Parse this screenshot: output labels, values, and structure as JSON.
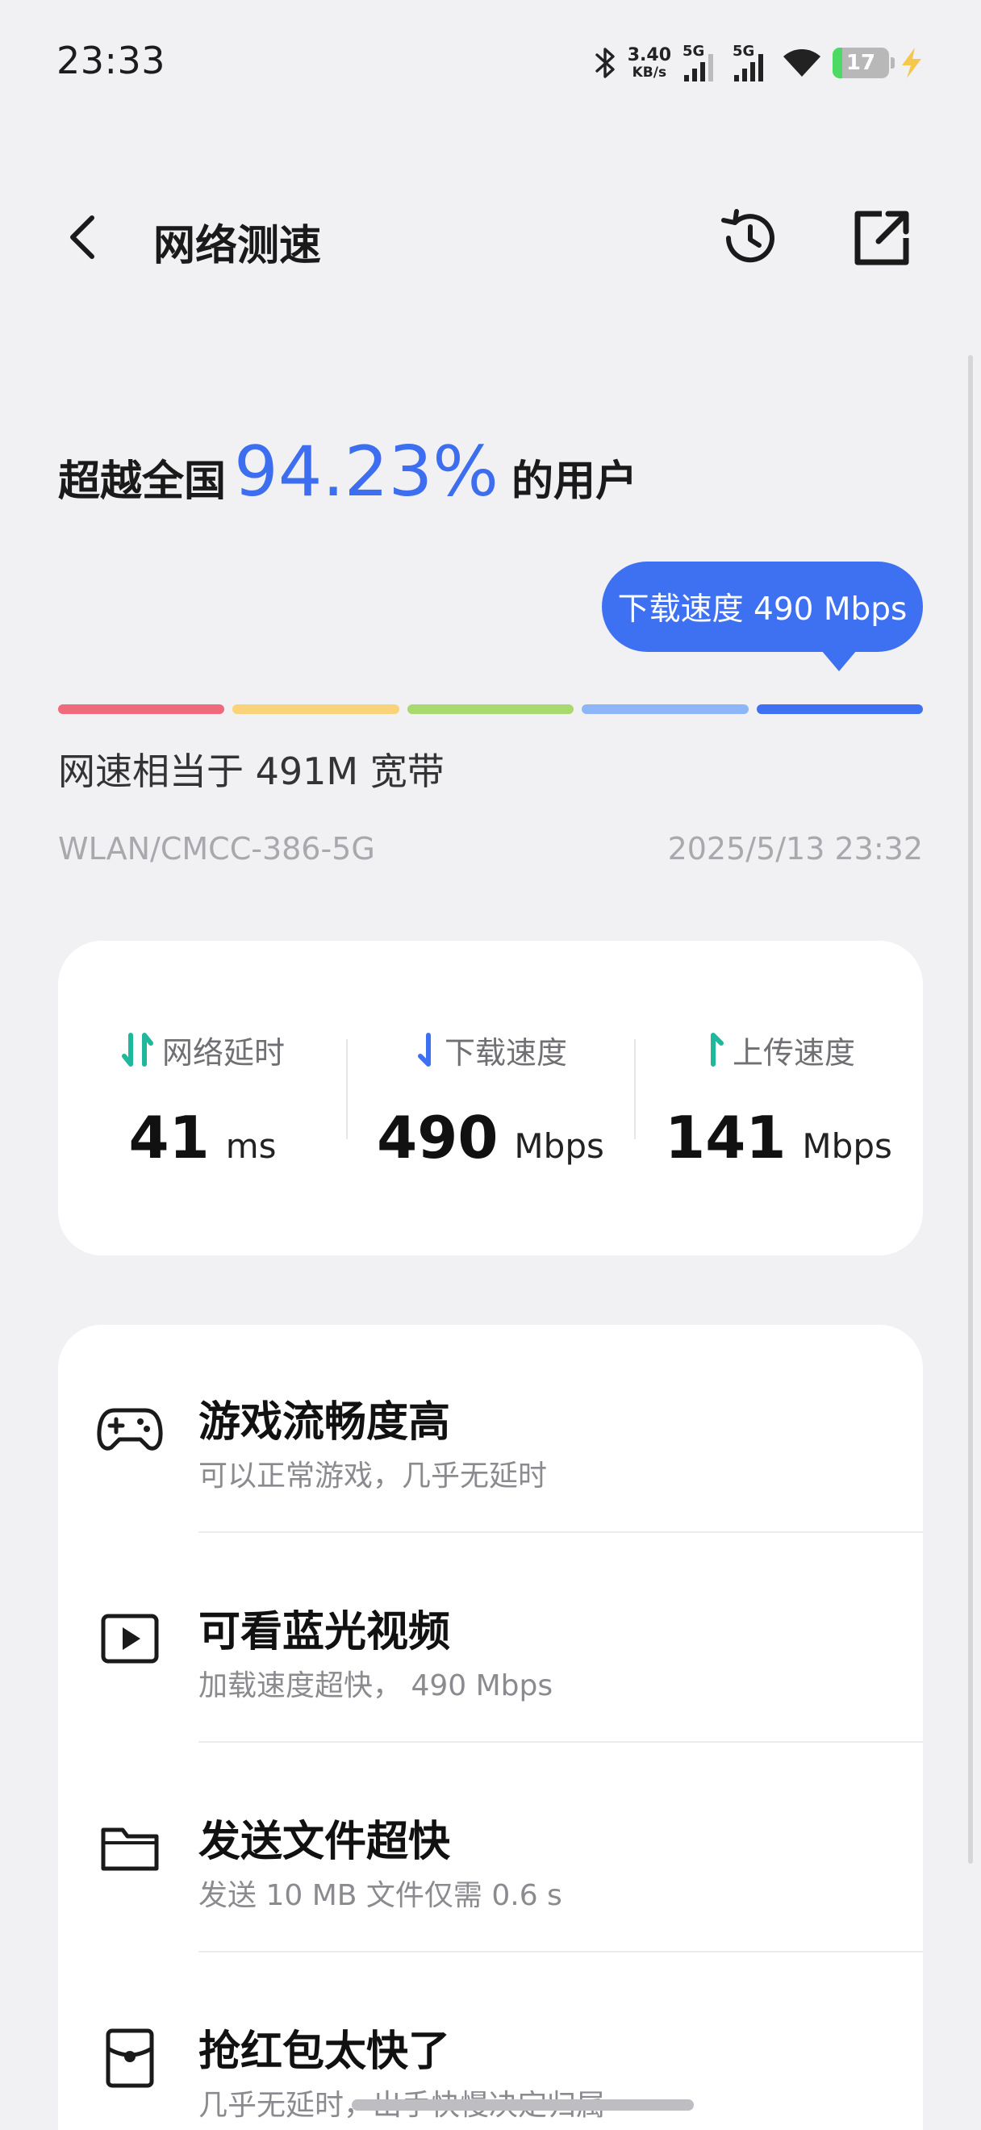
{
  "status_bar": {
    "time": "23:33",
    "net_speed_value": "3.40",
    "net_speed_unit": "KB/s",
    "sim1_tag": "5G",
    "sim2_tag": "5G",
    "battery_level": "17",
    "battery_fraction": 0.17,
    "icons": [
      "bluetooth-icon",
      "signal-icon",
      "signal-icon",
      "wifi-icon",
      "battery-icon",
      "charging-icon"
    ]
  },
  "header": {
    "title": "网络测速",
    "icons": [
      "chevron-left-icon",
      "history-icon",
      "share-icon"
    ]
  },
  "result": {
    "prefix": "超越全国",
    "percent": "94.23%",
    "suffix": "的用户",
    "tooltip": "下载速度 490 Mbps",
    "scale_colors": [
      "#ee6a7c",
      "#f9d27a",
      "#a8d86e",
      "#8cb6f7",
      "#3e70f2"
    ],
    "equivalent": "网速相当于 491M 宽带",
    "network": "WLAN/CMCC-386-5G",
    "tested_at": "2025/5/13 23:32"
  },
  "stats": {
    "latency": {
      "label": "网络延时",
      "value": "41",
      "unit": "ms",
      "color": "#1fb89a"
    },
    "download": {
      "label": "下载速度",
      "value": "490",
      "unit": "Mbps",
      "color": "#3e70f2"
    },
    "upload": {
      "label": "上传速度",
      "value": "141",
      "unit": "Mbps",
      "color": "#1fb89a"
    }
  },
  "features": [
    {
      "title": "游戏流畅度高",
      "desc": "可以正常游戏，几乎无延时",
      "icon": "gamepad-icon"
    },
    {
      "title": "可看蓝光视频",
      "desc": "加载速度超快， 490 Mbps",
      "icon": "video-play-icon"
    },
    {
      "title": "发送文件超快",
      "desc": "发送 10 MB 文件仅需 0.6 s",
      "icon": "folder-icon"
    },
    {
      "title": "抢红包太快了",
      "desc": "几乎无延时，出手快慢决定归属",
      "icon": "red-packet-icon"
    }
  ]
}
